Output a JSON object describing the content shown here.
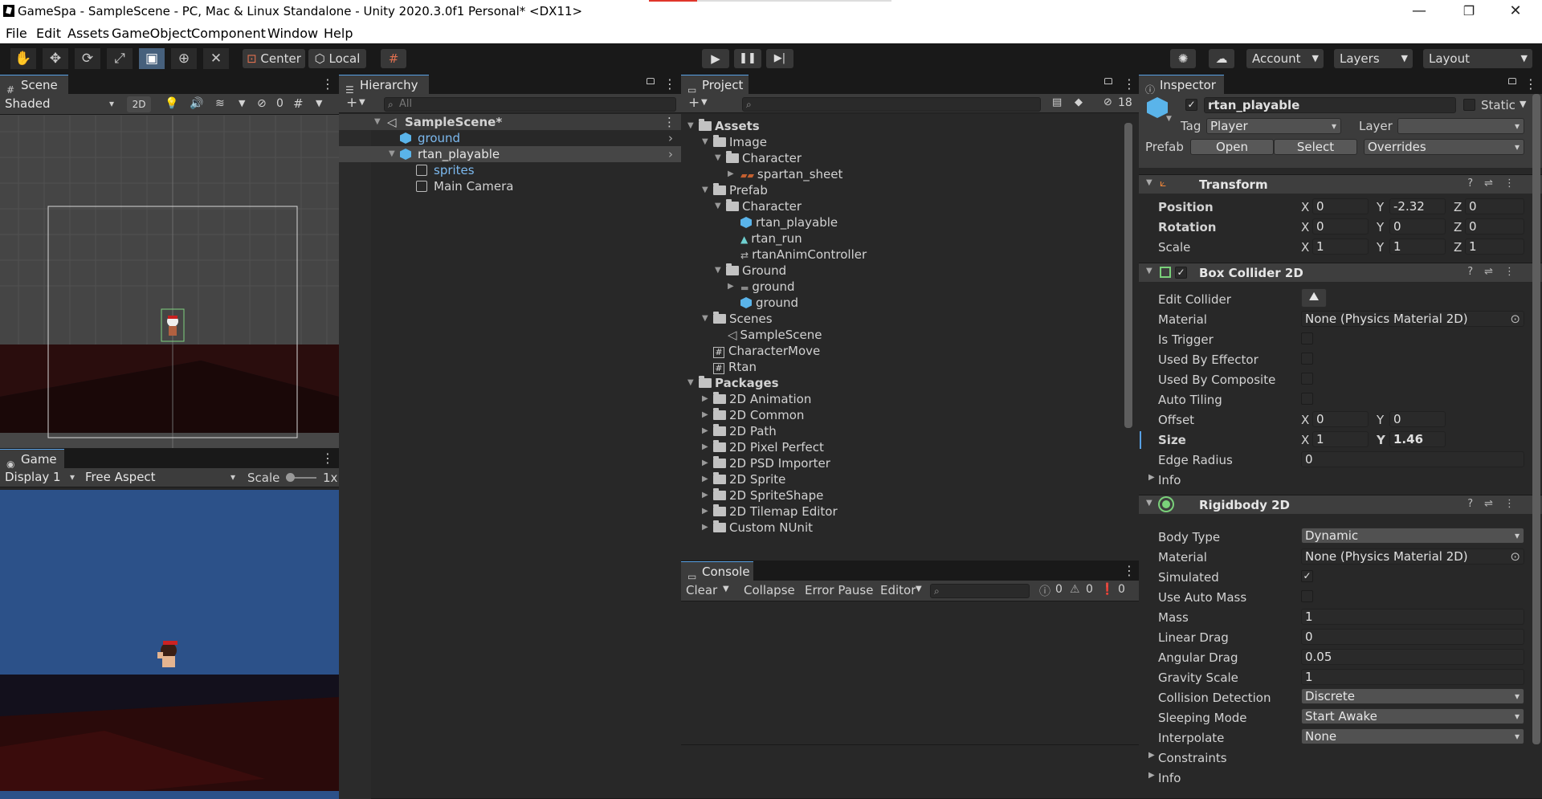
{
  "window": {
    "title": "GameSpa - SampleScene - PC, Mac & Linux Standalone - Unity 2020.3.0f1 Personal* <DX11>"
  },
  "menu": [
    "File",
    "Edit",
    "Assets",
    "GameObject",
    "Component",
    "Window",
    "Help"
  ],
  "toolbar": {
    "center_label": "Center",
    "local_label": "Local",
    "account_label": "Account",
    "layers_label": "Layers",
    "layout_label": "Layout"
  },
  "scene": {
    "tab": "Scene",
    "shading": "Shaded",
    "mode_2d": "2D",
    "hidden_count": "0"
  },
  "game": {
    "tab": "Game",
    "display": "Display 1",
    "aspect": "Free Aspect",
    "scale_label": "Scale",
    "scale_value": "1x"
  },
  "hierarchy": {
    "tab": "Hierarchy",
    "search_placeholder": "All",
    "items": [
      {
        "label": "SampleScene*"
      },
      {
        "label": "ground"
      },
      {
        "label": "rtan_playable"
      },
      {
        "label": "sprites"
      },
      {
        "label": "Main Camera"
      }
    ]
  },
  "project": {
    "tab": "Project",
    "hidden_count": "18",
    "tree": [
      "Assets",
      "Image",
      "Character",
      "spartan_sheet",
      "Prefab",
      "Character",
      "rtan_playable",
      "rtan_run",
      "rtanAnimController",
      "Ground",
      "ground",
      "ground",
      "Scenes",
      "SampleScene",
      "CharacterMove",
      "Rtan",
      "Packages",
      "2D Animation",
      "2D Common",
      "2D Path",
      "2D Pixel Perfect",
      "2D PSD Importer",
      "2D Sprite",
      "2D SpriteShape",
      "2D Tilemap Editor",
      "Custom NUnit"
    ]
  },
  "console": {
    "tab": "Console",
    "clear": "Clear",
    "collapse": "Collapse",
    "error_pause": "Error Pause",
    "editor": "Editor",
    "count_log": "0",
    "count_warn": "0",
    "count_err": "0"
  },
  "inspector": {
    "tab": "Inspector",
    "object_name": "rtan_playable",
    "static_label": "Static",
    "tag_label": "Tag",
    "tag_value": "Player",
    "layer_label": "Layer",
    "prefab_label": "Prefab",
    "open": "Open",
    "select": "Select",
    "overrides": "Overrides",
    "transform": {
      "title": "Transform",
      "position": "Position",
      "rotation": "Rotation",
      "scale": "Scale",
      "px": "0",
      "py": "-2.32",
      "pz": "0",
      "rx": "0",
      "ry": "0",
      "rz": "0",
      "sx": "1",
      "sy": "1",
      "sz": "1"
    },
    "box": {
      "title": "Box Collider 2D",
      "edit_collider": "Edit Collider",
      "material": "Material",
      "material_value": "None (Physics Material 2D)",
      "is_trigger": "Is Trigger",
      "used_by_effector": "Used By Effector",
      "used_by_composite": "Used By Composite",
      "auto_tiling": "Auto Tiling",
      "offset": "Offset",
      "ox": "0",
      "oy": "0",
      "size": "Size",
      "sx": "1",
      "sy": "1.46",
      "edge_radius": "Edge Radius",
      "edge_value": "0",
      "info": "Info"
    },
    "rb": {
      "title": "Rigidbody 2D",
      "body_type": "Body Type",
      "body_type_value": "Dynamic",
      "material": "Material",
      "material_value": "None (Physics Material 2D)",
      "simulated": "Simulated",
      "use_auto_mass": "Use Auto Mass",
      "mass": "Mass",
      "mass_value": "1",
      "linear_drag": "Linear Drag",
      "linear_drag_value": "0",
      "angular_drag": "Angular Drag",
      "angular_drag_value": "0.05",
      "gravity_scale": "Gravity Scale",
      "gravity_scale_value": "1",
      "collision_detection": "Collision Detection",
      "collision_detection_value": "Discrete",
      "sleeping_mode": "Sleeping Mode",
      "sleeping_mode_value": "Start Awake",
      "interpolate": "Interpolate",
      "interpolate_value": "None",
      "constraints": "Constraints",
      "info": "Info"
    },
    "xyz": [
      "X",
      "Y",
      "Z"
    ]
  }
}
